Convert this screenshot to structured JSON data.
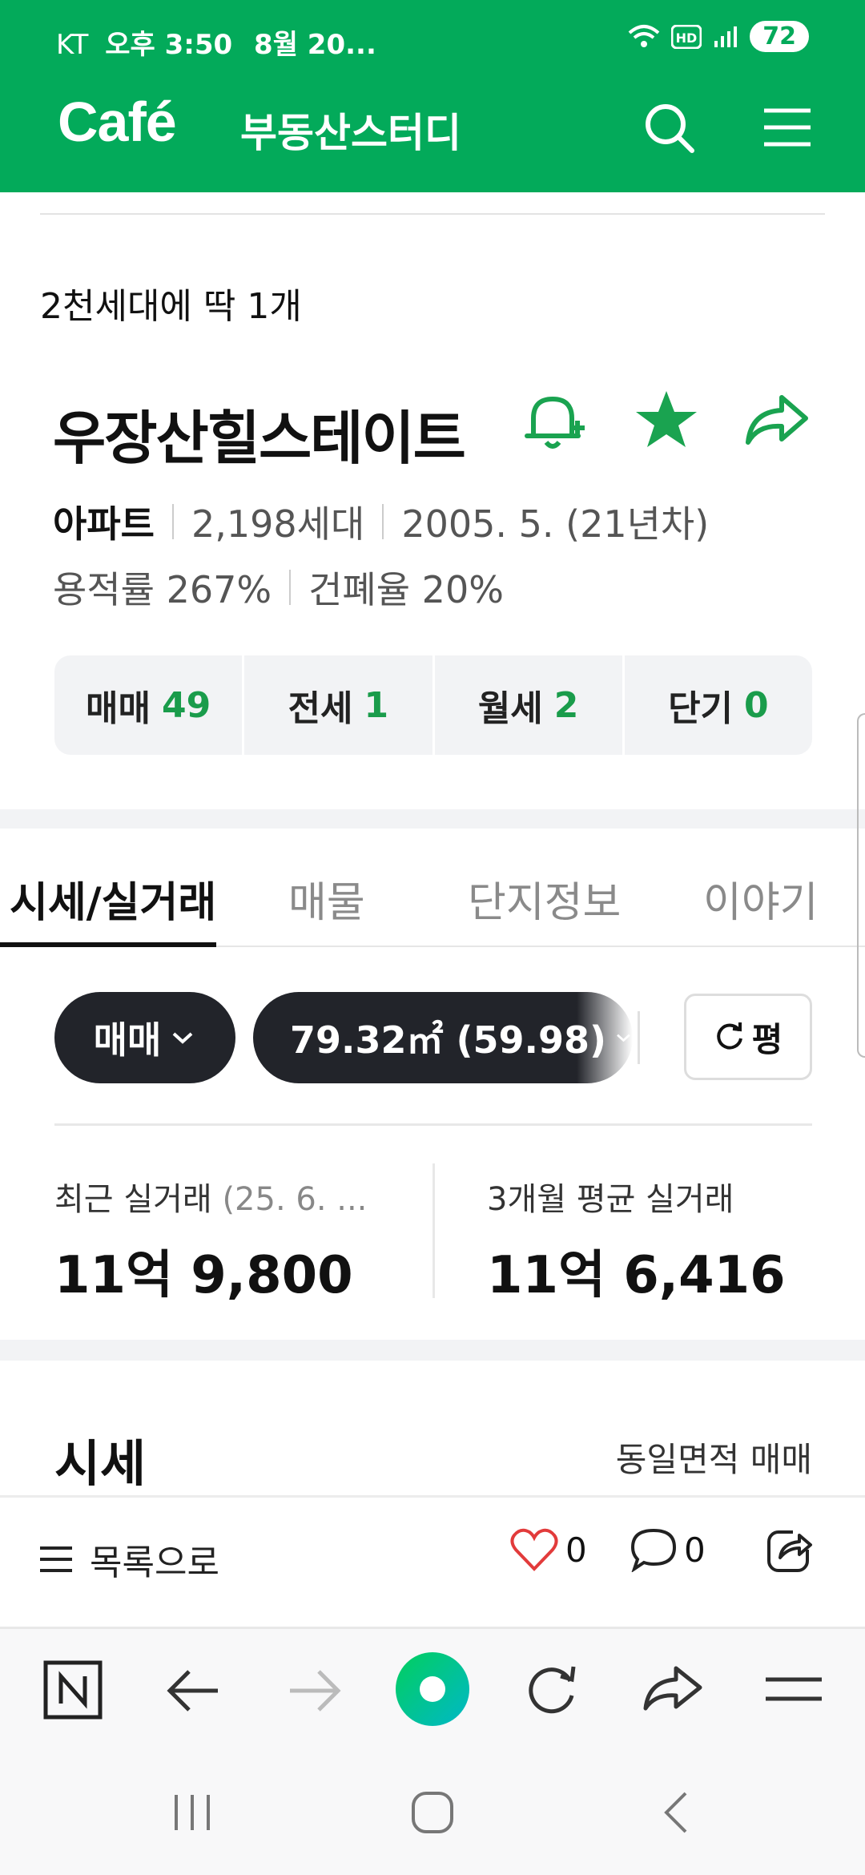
{
  "status": {
    "carrier": "KT",
    "time_text": "오후 3:50",
    "date_text": "8월 20...",
    "battery": "72"
  },
  "header": {
    "logo": "Café",
    "cafe_name": "부동산스터디"
  },
  "post": {
    "text": "2천세대에  딱  1개"
  },
  "apartment": {
    "name": "우장산힐스테이트",
    "type": "아파트",
    "households": "2,198세대",
    "built": "2005. 5. (21년차)",
    "floor_area_ratio": "용적률 267%",
    "coverage_ratio": "건폐율 20%"
  },
  "deals": [
    {
      "label": "매매",
      "count": "49"
    },
    {
      "label": "전세",
      "count": "1"
    },
    {
      "label": "월세",
      "count": "2"
    },
    {
      "label": "단기",
      "count": "0"
    }
  ],
  "tabs": [
    "시세/실거래",
    "매물",
    "단지정보",
    "이야기"
  ],
  "filters": {
    "deal_type": "매매",
    "area": "79.32㎡ (59.98)",
    "unit_label": "평"
  },
  "prices": {
    "recent_label": "최근 실거래",
    "recent_date": "(25. 6. ...",
    "recent_value": "11억 9,800",
    "avg_label": "3개월 평균 실거래",
    "avg_value": "11억 6,416"
  },
  "sise": {
    "title": "시세",
    "right_label": "동일면적 매매"
  },
  "list_bar": {
    "back_label": "목록으로",
    "likes": "0",
    "comments": "0"
  },
  "colors": {
    "brand": "#03AA5A",
    "count_green": "#1a9c4b"
  }
}
